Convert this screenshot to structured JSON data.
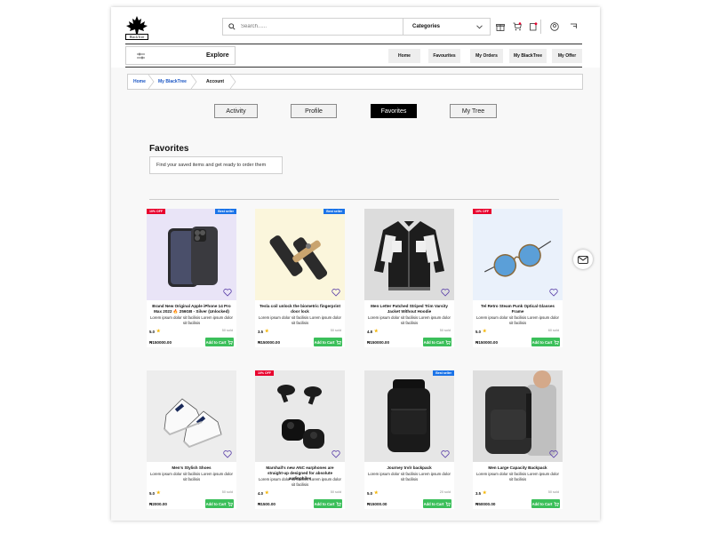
{
  "brand": {
    "logo_text": "BlackTree"
  },
  "header": {
    "search_placeholder": "Search......",
    "categories_label": "Categories"
  },
  "navbar": {
    "explore_label": "Explore",
    "links": [
      "Home",
      "Favourites",
      "My Orders",
      "My BlackTree",
      "My Offer"
    ]
  },
  "breadcrumb": [
    "Home",
    "My BlackTree",
    "Account"
  ],
  "tabs": [
    "Activity",
    "Profile",
    "Favorites",
    "My Tree"
  ],
  "active_tab": "Favorites",
  "favorites": {
    "title": "Favorites",
    "subtitle": "Find your saved items and get ready to order them"
  },
  "add_to_cart_label": "Add to Cart",
  "colors": {
    "accent": "#3bbf5a",
    "discount": "#e8002d",
    "bestseller": "#1a73e8",
    "star": "#f5b400"
  },
  "products": [
    {
      "title": "Brand New Original Apple iPhone 14 Pro Max 2022 🔥 256GB - Silver (Unlocked)",
      "desc": "Lorem ipsum dolor sit facilisis Lorem ipsum dolor sit facilisis",
      "rating": "5.0",
      "sold": "50 sold",
      "price": "₦150000.00",
      "badge_off": "10% OFF",
      "badge_best": "Best seller",
      "image": "iphone"
    },
    {
      "title": "Tesla coil unlock the biometric fingerprint door lock",
      "desc": "Lorem ipsum dolor sit facilisis Lorem ipsum dolor sit facilisis",
      "rating": "3.5",
      "sold": "50 sold",
      "price": "₦150000.00",
      "badge_off": "",
      "badge_best": "Best seller",
      "image": "doorlock"
    },
    {
      "title": "Men Letter Patched Striped Trim Varsity Jacket Without Hoodie",
      "desc": "Lorem ipsum dolor sit facilisis Lorem ipsum dolor sit facilisis",
      "rating": "4.8",
      "sold": "50 sold",
      "price": "₦150000.00",
      "badge_off": "",
      "badge_best": "",
      "image": "jacket"
    },
    {
      "title": "Tel Retro Steam Punk Optical Glasses Frame",
      "desc": "Lorem ipsum dolor sit facilisis Lorem ipsum dolor sit facilisis",
      "rating": "5.0",
      "sold": "60 sold",
      "price": "₦150000.00",
      "badge_off": "10% OFF",
      "badge_best": "",
      "image": "glasses"
    },
    {
      "title": "Men's Stylish Shoes",
      "desc": "Lorem ipsum dolor sit facilisis Lorem ipsum dolor sit facilisis",
      "rating": "5.0",
      "sold": "50 sold",
      "price": "₦2000.00",
      "badge_off": "",
      "badge_best": "",
      "image": "shoes"
    },
    {
      "title": "Marshall's new ANC earphones are straight-up designed for absolute audiophiles",
      "desc": "Lorem ipsum dolor sit facilisis Lorem ipsum dolor sit facilisis",
      "rating": "4.0",
      "sold": "50 sold",
      "price": "₦1500.00",
      "badge_off": "10% OFF",
      "badge_best": "",
      "image": "earbuds"
    },
    {
      "title": "Journey trvlr backpack",
      "desc": "Lorem ipsum dolor sit facilisis Lorem ipsum dolor sit facilisis",
      "rating": "5.0",
      "sold": "20 sold",
      "price": "₦15000.00",
      "badge_off": "",
      "badge_best": "Best seller",
      "image": "backpack"
    },
    {
      "title": "Men Large Capacity Backpack",
      "desc": "Lorem ipsum dolor sit facilisis Lorem ipsum dolor sit facilisis",
      "rating": "3.5",
      "sold": "50 sold",
      "price": "₦50000.00",
      "badge_off": "",
      "badge_best": "",
      "image": "backpack2"
    }
  ]
}
